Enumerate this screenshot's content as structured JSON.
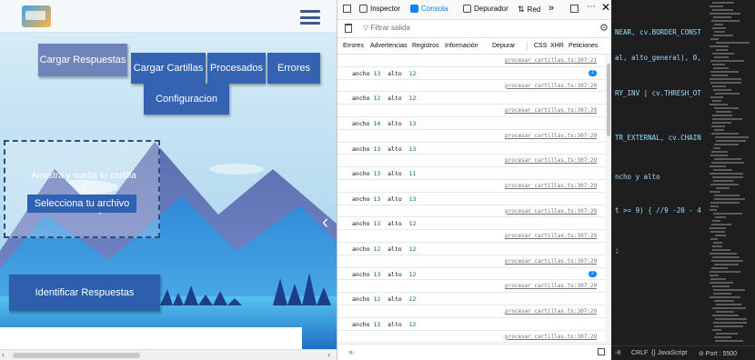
{
  "app": {
    "nav": {
      "cargar_respuestas": "Cargar Respuestas",
      "cargar_cartillas": "Cargar Cartillas",
      "procesados": "Procesados",
      "errores": "Errores",
      "configuracion": "Configuracion"
    },
    "dropzone": {
      "text": "Arrastra y suelta tu cartilla",
      "or": "o",
      "button": "Selecciona tu archivo"
    },
    "identify_button": "Identificar Respuestas"
  },
  "devtools": {
    "tabs": [
      {
        "label": "Inspector",
        "icon": "inspector-icon"
      },
      {
        "label": "Consola",
        "icon": "console-icon"
      },
      {
        "label": "Depurador",
        "icon": "debugger-icon"
      },
      {
        "label": "Red",
        "icon": "network-icon"
      }
    ],
    "more": "»",
    "filter_placeholder": "Filtrar salida",
    "categories": [
      "Errores",
      "Advertencias",
      "Registros",
      "Información",
      "Depurar",
      "CSS",
      "XHR",
      "Peticiones"
    ],
    "log": [
      {
        "ancho": "",
        "alto": "",
        "src": "procesar cartillas.ts:307:21",
        "badge": ""
      },
      {
        "ancho": "13",
        "alto": "12",
        "src": "",
        "badge": "2"
      },
      {
        "ancho": "",
        "alto": "",
        "src": "procesar cartillas.ts:307:29",
        "badge": ""
      },
      {
        "ancho": "12",
        "alto": "12",
        "src": "",
        "badge": ""
      },
      {
        "ancho": "",
        "alto": "",
        "src": "procesar cartillas.ts:307:29",
        "badge": ""
      },
      {
        "ancho": "14",
        "alto": "13",
        "src": "",
        "badge": ""
      },
      {
        "ancho": "",
        "alto": "",
        "src": "procesar cartillas.ts:307:29",
        "badge": ""
      },
      {
        "ancho": "13",
        "alto": "13",
        "src": "",
        "badge": ""
      },
      {
        "ancho": "",
        "alto": "",
        "src": "procesar cartillas.ts:307:29",
        "badge": ""
      },
      {
        "ancho": "13",
        "alto": "11",
        "src": "",
        "badge": ""
      },
      {
        "ancho": "",
        "alto": "",
        "src": "procesar cartillas.ts:307:29",
        "badge": ""
      },
      {
        "ancho": "13",
        "alto": "13",
        "src": "",
        "badge": ""
      },
      {
        "ancho": "",
        "alto": "",
        "src": "procesar cartillas.ts:307:29",
        "badge": ""
      },
      {
        "ancho": "13",
        "alto": "12",
        "src": "",
        "badge": ""
      },
      {
        "ancho": "",
        "alto": "",
        "src": "procesar cartillas.ts:307:29",
        "badge": ""
      },
      {
        "ancho": "12",
        "alto": "12",
        "src": "",
        "badge": ""
      },
      {
        "ancho": "",
        "alto": "",
        "src": "procesar cartillas.ts:307:29",
        "badge": ""
      },
      {
        "ancho": "13",
        "alto": "12",
        "src": "",
        "badge": "2"
      },
      {
        "ancho": "",
        "alto": "",
        "src": "procesar cartillas.ts:307:29",
        "badge": ""
      },
      {
        "ancho": "12",
        "alto": "12",
        "src": "",
        "badge": ""
      },
      {
        "ancho": "",
        "alto": "",
        "src": "procesar cartillas.ts:307:29",
        "badge": ""
      },
      {
        "ancho": "13",
        "alto": "12",
        "src": "",
        "badge": ""
      },
      {
        "ancho": "",
        "alto": "",
        "src": "procesar cartillas.ts:307:29",
        "badge": ""
      }
    ],
    "prompt": "»"
  },
  "editor": {
    "lines": [
      {
        "text": "NEAR, cv.BORDER_CONST"
      },
      {
        "text": "al, alto_general), 0,"
      },
      {
        "text": "RY_INV | cv.THRESH_OT"
      },
      {
        "text": "TR_EXTERNAL, cv.CHAIN"
      },
      {
        "text": "ncho y alto"
      },
      {
        "text": "t >= 9) { //9 -20 - 4"
      },
      {
        "text": ";"
      }
    ],
    "status": {
      "eol": "CRLF",
      "lang": "{} JavaScript",
      "port": "⊘ Port : 5500",
      "enc": "-8"
    }
  }
}
